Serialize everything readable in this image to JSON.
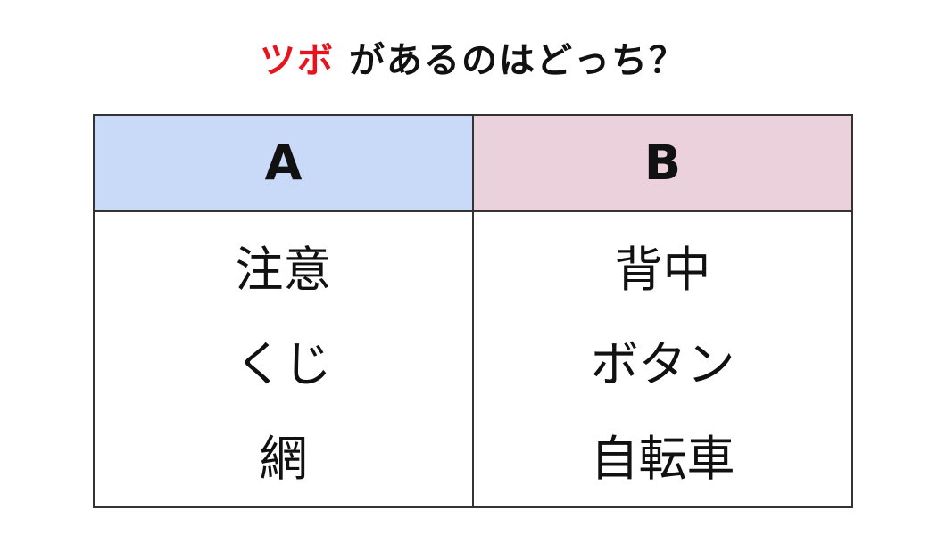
{
  "title": {
    "highlight": "ツボ",
    "rest": "があるのはどっち？"
  },
  "colors": {
    "highlight": "#e8141c",
    "header_a": "#c9daf8",
    "header_b": "#ead1dc",
    "border": "#333333"
  },
  "table": {
    "headers": [
      "A",
      "B"
    ],
    "column_a": [
      "注意",
      "くじ",
      "網"
    ],
    "column_b": [
      "背中",
      "ボタン",
      "自転車"
    ]
  }
}
